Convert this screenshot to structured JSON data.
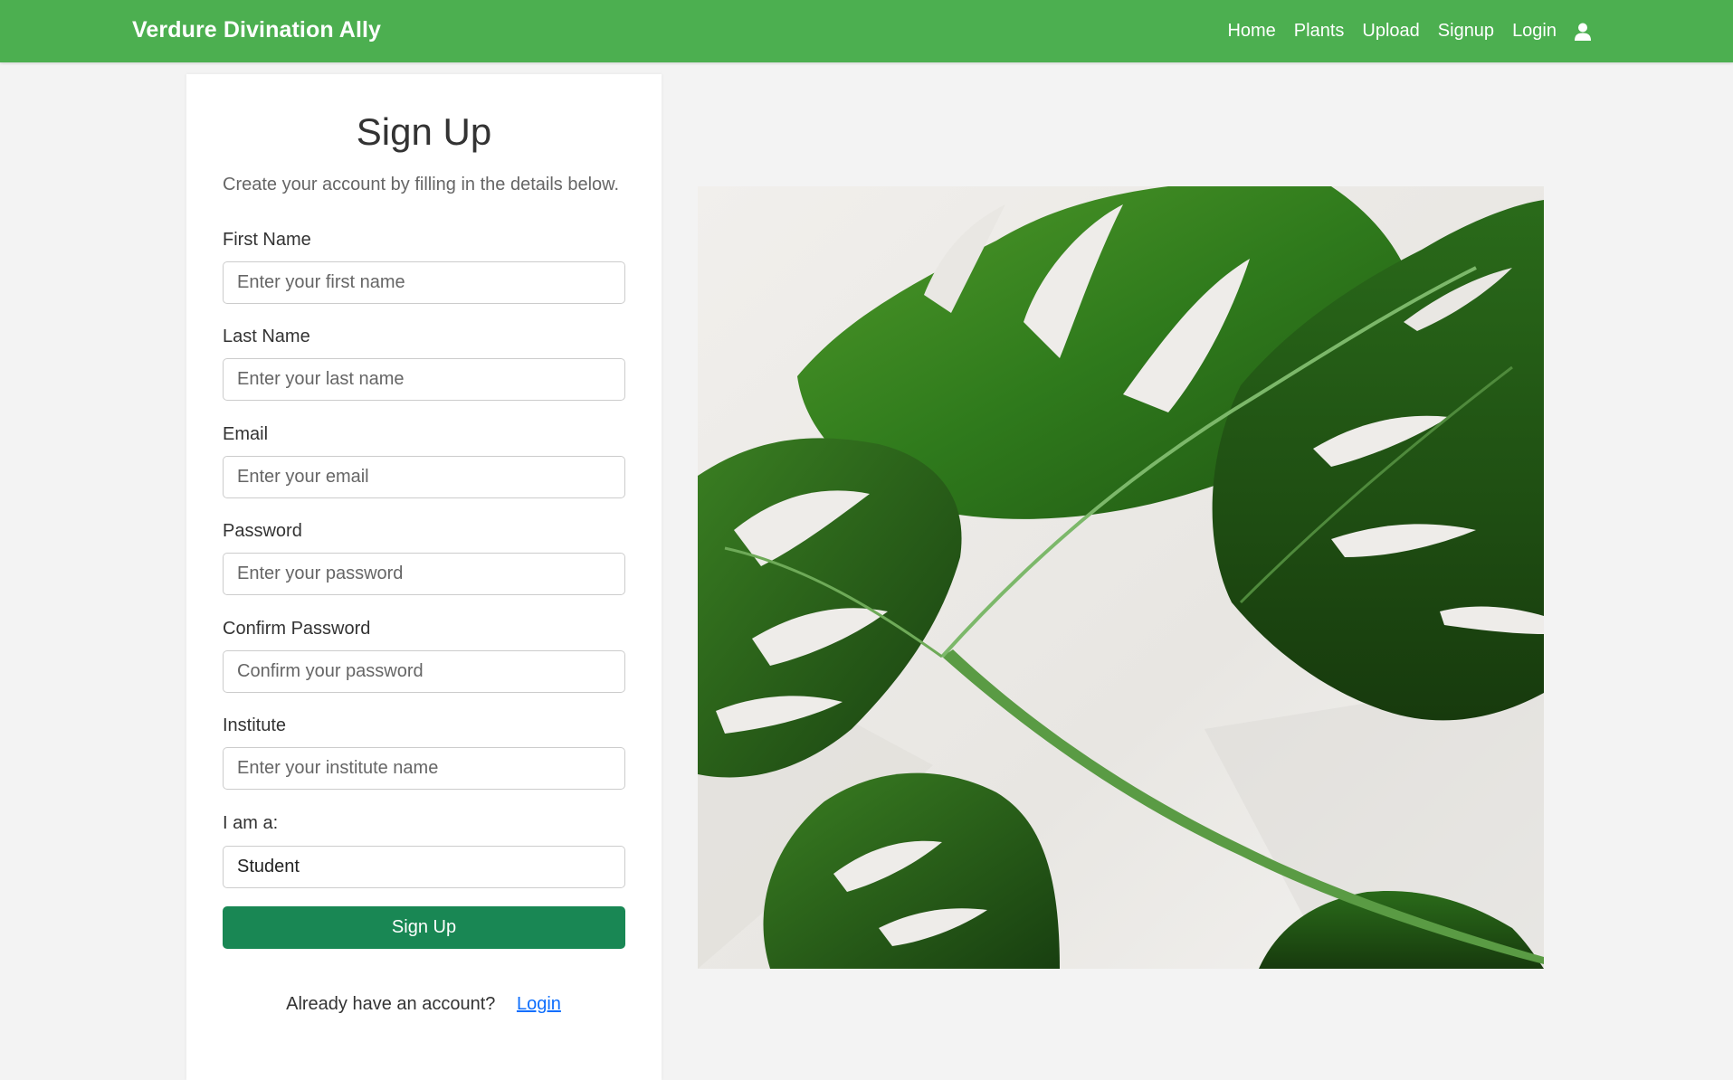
{
  "navbar": {
    "brand": "Verdure Divination Ally",
    "links": [
      "Home",
      "Plants",
      "Upload",
      "Signup",
      "Login"
    ],
    "user_icon": "user-icon",
    "background": "#4caf50"
  },
  "form": {
    "title": "Sign Up",
    "subtitle": "Create your account by filling in the details below.",
    "fields": [
      {
        "label": "First Name",
        "placeholder": "Enter your first name",
        "value": ""
      },
      {
        "label": "Last Name",
        "placeholder": "Enter your last name",
        "value": ""
      },
      {
        "label": "Email",
        "placeholder": "Enter your email",
        "value": ""
      },
      {
        "label": "Password",
        "placeholder": "Enter your password",
        "value": ""
      },
      {
        "label": "Confirm Password",
        "placeholder": "Confirm your password",
        "value": ""
      },
      {
        "label": "Institute",
        "placeholder": "Enter your institute name",
        "value": ""
      }
    ],
    "role_label": "I am a:",
    "role_selected": "Student",
    "submit_label": "Sign Up",
    "submit_color": "#198754",
    "login_prompt": "Already have an account?",
    "login_link": "Login"
  },
  "hero": {
    "image_name": "monstera-leaves-image"
  }
}
